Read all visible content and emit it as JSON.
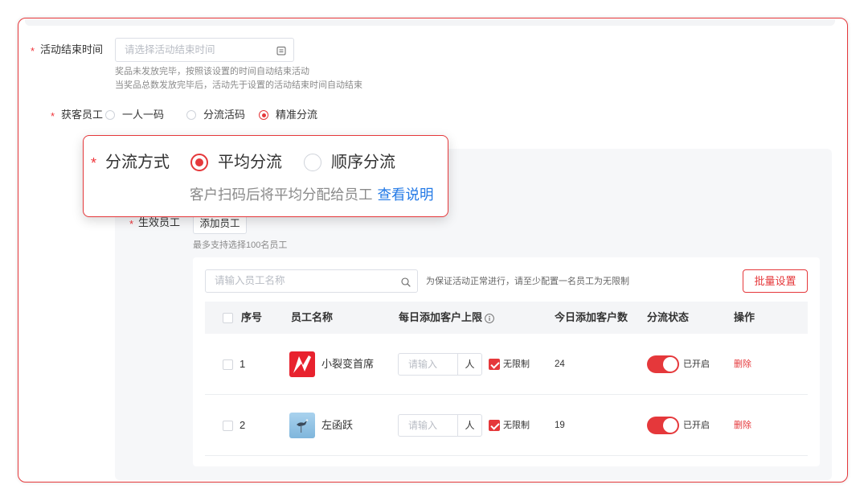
{
  "form": {
    "end_time": {
      "required_mark": "*",
      "label": "活动结束时间",
      "placeholder": "请选择活动结束时间",
      "icon": "calendar-icon",
      "hints": [
        "奖品未发放完毕，按照该设置的时间自动结束活动",
        "当奖品总数发放完毕后，活动先于设置的活动结束时间自动结束"
      ]
    },
    "acquire_staff": {
      "required_mark": "*",
      "label": "获客员工",
      "options": [
        {
          "label": "一人一码",
          "checked": false
        },
        {
          "label": "分流活码",
          "checked": false
        },
        {
          "label": "精准分流",
          "checked": true
        }
      ]
    },
    "active_staff": {
      "required_mark": "*",
      "label": "生效员工",
      "add_button": "添加员工",
      "hint": "最多支持选择100名员工"
    }
  },
  "split_popup": {
    "required_mark": "*",
    "label": "分流方式",
    "options": [
      {
        "label": "平均分流",
        "checked": true
      },
      {
        "label": "顺序分流",
        "checked": false
      }
    ],
    "hint": "客户扫码后将平均分配给员工",
    "link": "查看说明"
  },
  "staff_table": {
    "search_placeholder": "请输入员工名称",
    "search_icon": "search-icon",
    "notice": "为保证活动正常进行，请至少配置一名员工为无限制",
    "batch_button": "批量设置",
    "header_checked": false,
    "columns": {
      "index": "序号",
      "name": "员工名称",
      "daily_limit": "每日添加客户上限",
      "today_added": "今日添加客户数",
      "status": "分流状态",
      "action": "操作"
    },
    "info_icon": "info-icon",
    "rows": [
      {
        "checked": false,
        "index": "1",
        "avatar_icon": "brand-logo-avatar",
        "name": "小裂变首席",
        "limit_placeholder": "请输入",
        "unit": "人",
        "unlimited": true,
        "unlimited_label": "无限制",
        "today_added": "24",
        "status_on": true,
        "status_label": "已开启",
        "action": "删除"
      },
      {
        "checked": false,
        "index": "2",
        "avatar_icon": "photo-avatar",
        "name": "左函跃",
        "limit_placeholder": "请输入",
        "unit": "人",
        "unlimited": true,
        "unlimited_label": "无限制",
        "today_added": "19",
        "status_on": true,
        "status_label": "已开启",
        "action": "删除"
      }
    ]
  },
  "colors": {
    "accent": "#e5383b",
    "link": "#2279e6",
    "panel": "#f6f7f9"
  }
}
